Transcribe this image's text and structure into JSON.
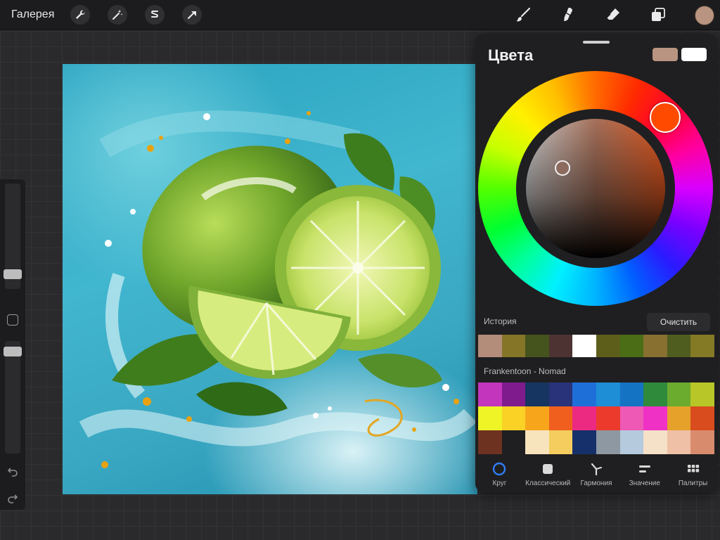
{
  "topbar": {
    "gallery_label": "Галерея",
    "left_tools": [
      "wrench-icon",
      "magic-wand-icon",
      "selection-icon",
      "transform-arrow-icon"
    ],
    "right_tools": [
      "brush-icon",
      "smudge-icon",
      "eraser-icon",
      "layers-icon"
    ],
    "current_color": "#b99480"
  },
  "colors_panel": {
    "title": "Цвета",
    "primary_color": "#b99480",
    "secondary_color": "#ffffff",
    "history": {
      "label": "История",
      "clear_label": "Очистить",
      "swatches": [
        "#b48c7a",
        "#857527",
        "#45531d",
        "#4d3433",
        "#ffffff",
        "#5e5e1b",
        "#4a6d16",
        "#887030",
        "#4f5d1f",
        "#847a26"
      ]
    },
    "palette": {
      "name": "Frankentoon - Nomad",
      "swatches": [
        "#c335bd",
        "#7f1b8c",
        "#163560",
        "#283379",
        "#1f6fd9",
        "#1e8ed6",
        "#1573c4",
        "#2f8a3c",
        "#6bab2e",
        "#b9c627",
        "#eef425",
        "#fad125",
        "#f7a61c",
        "#f05f1e",
        "#ec2a82",
        "#ec3a2c",
        "#ee59b6",
        "#ef31c5",
        "#e6a12a",
        "#d84c1d",
        "#6e3221",
        "#1f1f21",
        "#f7e3bc",
        "#f4cd5e",
        "#16306b",
        "#8d98a2",
        "#b5cadc",
        "#f5e0c8",
        "#efc0a5",
        "#d98b6e"
      ]
    },
    "tabs": [
      {
        "label": "Круг",
        "icon": "disc-icon",
        "active": true
      },
      {
        "label": "Классический",
        "icon": "square-icon",
        "active": false
      },
      {
        "label": "Гармония",
        "icon": "harmony-icon",
        "active": false
      },
      {
        "label": "Значение",
        "icon": "sliders-icon",
        "active": false
      },
      {
        "label": "Палитры",
        "icon": "grid-icon",
        "active": false
      }
    ]
  }
}
